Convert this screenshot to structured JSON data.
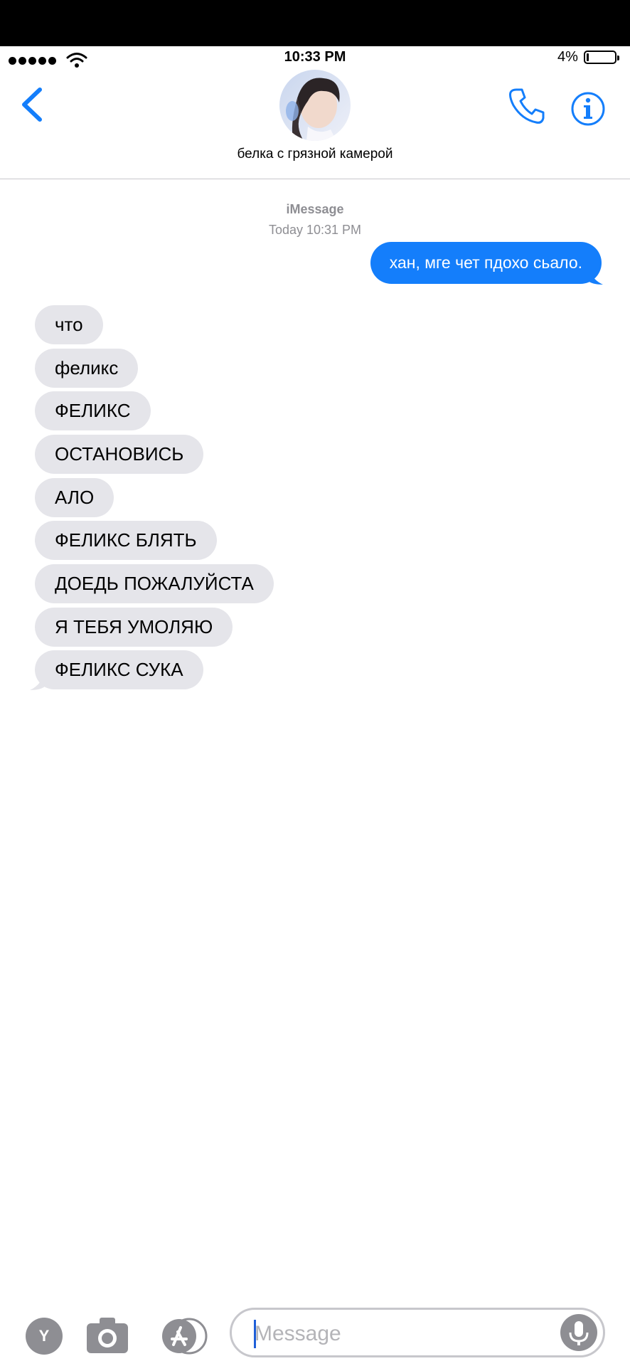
{
  "status": {
    "time": "10:33 PM",
    "battery_pct": "4%"
  },
  "header": {
    "contact_name": "белка с грязной камерой",
    "avatar_icon": "contact-photo"
  },
  "thread": {
    "service": "iMessage",
    "timestamp": "Today 10:31 PM",
    "outgoing": [
      {
        "text": "хан, мге чет пдохо сьало."
      }
    ],
    "incoming": [
      {
        "text": "что"
      },
      {
        "text": "феликс"
      },
      {
        "text": "ФЕЛИКС"
      },
      {
        "text": "ОСТАНОВИСЬ"
      },
      {
        "text": "АЛО"
      },
      {
        "text": "ФЕЛИКС БЛЯТЬ"
      },
      {
        "text": "ДОЕДЬ ПОЖАЛУЙСТА"
      },
      {
        "text": "Я ТЕБЯ УМОЛЯЮ"
      },
      {
        "text": "ФЕЛИКС СУКА"
      }
    ]
  },
  "composer": {
    "app_button_label": "Y",
    "placeholder": "Message"
  },
  "colors": {
    "accent": "#147efb",
    "incoming_bubble": "#e5e5ea",
    "secondary_text": "#8e8e93"
  }
}
